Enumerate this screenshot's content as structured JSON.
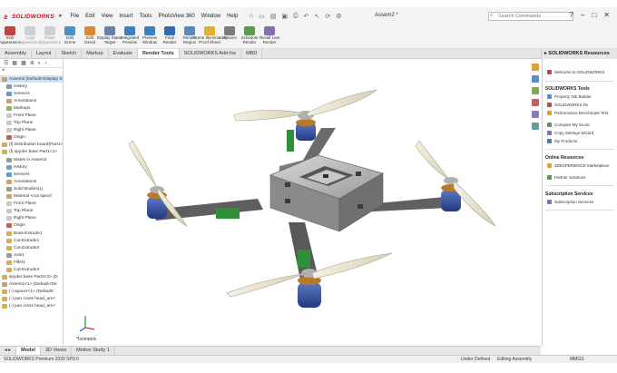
{
  "app": {
    "brand": "SOLIDWORKS",
    "doc_title": "Assem2 *"
  },
  "menus": [
    "File",
    "Edit",
    "View",
    "Insert",
    "Tools",
    "PhotoView 360",
    "Window",
    "Help"
  ],
  "search": {
    "placeholder": "Search Commands"
  },
  "ribbon": [
    {
      "label": "Edit\nAppearance",
      "color": "#c94040",
      "dim": false
    },
    {
      "label": "Copy\nAppearance",
      "color": "#9aa4b0",
      "dim": true
    },
    {
      "label": "Paste\nAppearance",
      "color": "#9aa4b0",
      "dim": true
    },
    {
      "label": "Edit\nScene",
      "color": "#4f8fc9",
      "dim": false
    },
    {
      "label": "Edit\nDecal",
      "color": "#d98a2f",
      "dim": false
    },
    {
      "label": "Display States\nTarget",
      "color": "#6a7fa8",
      "dim": false
    },
    {
      "label": "Integrated\nPreview",
      "color": "#3e7fbf",
      "dim": false
    },
    {
      "label": "Preview\nWindow",
      "color": "#3e7fbf",
      "dim": false
    },
    {
      "label": "Final\nRender",
      "color": "#2f6db0",
      "dim": false
    },
    {
      "label": "Render\nRegion",
      "color": "#5a88b8",
      "dim": false
    },
    {
      "label": "Scene Illumination\nProof Sheet",
      "color": "#e0b030",
      "dim": false
    },
    {
      "label": "Options",
      "color": "#7a7a7a",
      "dim": false
    },
    {
      "label": "Schedule\nRender",
      "color": "#5b9a4f",
      "dim": false
    },
    {
      "label": "Recall Last\nRender",
      "color": "#8a6bb0",
      "dim": false
    }
  ],
  "tabs": [
    "Assembly",
    "Layout",
    "Sketch",
    "Markup",
    "Evaluate",
    "Render Tools",
    "SOLIDWORKS Add-Ins",
    "MBD"
  ],
  "active_tab": "Render Tools",
  "tree": {
    "items": [
      {
        "label": "Assem2 (Default<Display S",
        "color": "#c9a46a",
        "indent": 0,
        "sel": true
      },
      {
        "label": "History",
        "color": "#7a9cc0",
        "indent": 1
      },
      {
        "label": "Sensors",
        "color": "#5a9fd4",
        "indent": 1
      },
      {
        "label": "Annotations",
        "color": "#c9a46a",
        "indent": 1
      },
      {
        "label": "Markups",
        "color": "#8fb35a",
        "indent": 1
      },
      {
        "label": "Front Plane",
        "color": "#c9c9c9",
        "indent": 1
      },
      {
        "label": "Top Plane",
        "color": "#c9c9c9",
        "indent": 1
      },
      {
        "label": "Right Plane",
        "color": "#c9c9c9",
        "indent": 1
      },
      {
        "label": "Origin",
        "color": "#c85a5a",
        "indent": 1
      },
      {
        "label": "(f) Distribution board(Part1<",
        "color": "#d4b24a",
        "indent": 0
      },
      {
        "label": "(f) spyder base Part1<1>",
        "color": "#d4b24a",
        "indent": 0
      },
      {
        "label": "Mates in Assem2",
        "color": "#9a9a9a",
        "indent": 1
      },
      {
        "label": "History",
        "color": "#7a9cc0",
        "indent": 1
      },
      {
        "label": "Sensors",
        "color": "#5a9fd4",
        "indent": 1
      },
      {
        "label": "Annotations",
        "color": "#c9a46a",
        "indent": 1
      },
      {
        "label": "Solid Bodies(1)",
        "color": "#9a9a9a",
        "indent": 1
      },
      {
        "label": "Material <not specif",
        "color": "#c9a46a",
        "indent": 1
      },
      {
        "label": "Front Plane",
        "color": "#c9c9c9",
        "indent": 1
      },
      {
        "label": "Top Plane",
        "color": "#c9c9c9",
        "indent": 1
      },
      {
        "label": "Right Plane",
        "color": "#c9c9c9",
        "indent": 1
      },
      {
        "label": "Origin",
        "color": "#c85a5a",
        "indent": 1
      },
      {
        "label": "Boss-Extrude1",
        "color": "#d4b24a",
        "indent": 1
      },
      {
        "label": "Cut-Extrude1",
        "color": "#d4b24a",
        "indent": 1
      },
      {
        "label": "Cut-Extrude2",
        "color": "#d4b24a",
        "indent": 1
      },
      {
        "label": "Axis1",
        "color": "#9a9a9a",
        "indent": 1
      },
      {
        "label": "Fillet1",
        "color": "#d4b24a",
        "indent": 1
      },
      {
        "label": "Cut-Extrude4",
        "color": "#d4b24a",
        "indent": 1
      },
      {
        "label": "spyder base Part2<2> (D",
        "color": "#d4b24a",
        "indent": 0
      },
      {
        "label": "Assem1<1> (Default<De",
        "color": "#c9a46a",
        "indent": 0
      },
      {
        "label": "(-) spacer<1> (Default<",
        "color": "#d4b24a",
        "indent": 0
      },
      {
        "label": "(-) pan cross head_am<",
        "color": "#d4b24a",
        "indent": 0
      },
      {
        "label": "(-) pan cross head_am<",
        "color": "#d4b24a",
        "indent": 0
      }
    ]
  },
  "viewport": {
    "view_label": "*Isometric"
  },
  "taskpane": {
    "title": "SOLIDWORKS Resources",
    "welcome": "Welcome to SOLIDWORKS",
    "sections": [
      {
        "title": "SOLIDWORKS Tools",
        "items": [
          "Property Tab Builder",
          "SOLIDWORKS Rx",
          "Performance Benchmark Test",
          "Compare My Score",
          "Copy Settings Wizard",
          "My Products"
        ]
      },
      {
        "title": "Online Resources",
        "items": [
          "3DEXPERIENCE Marketplace",
          "Partner Solutions"
        ]
      },
      {
        "title": "Subscription Services",
        "items": [
          "Subscription Services"
        ]
      }
    ]
  },
  "bottom_tabs": [
    "Model",
    "3D Views",
    "Motion Study 1"
  ],
  "active_bottom_tab": "Model",
  "status": {
    "left": "SOLIDWORKS Premium 2020 SP0.0",
    "mid1": "Under Defined",
    "mid2": "Editing Assembly",
    "units": "MMGS"
  }
}
